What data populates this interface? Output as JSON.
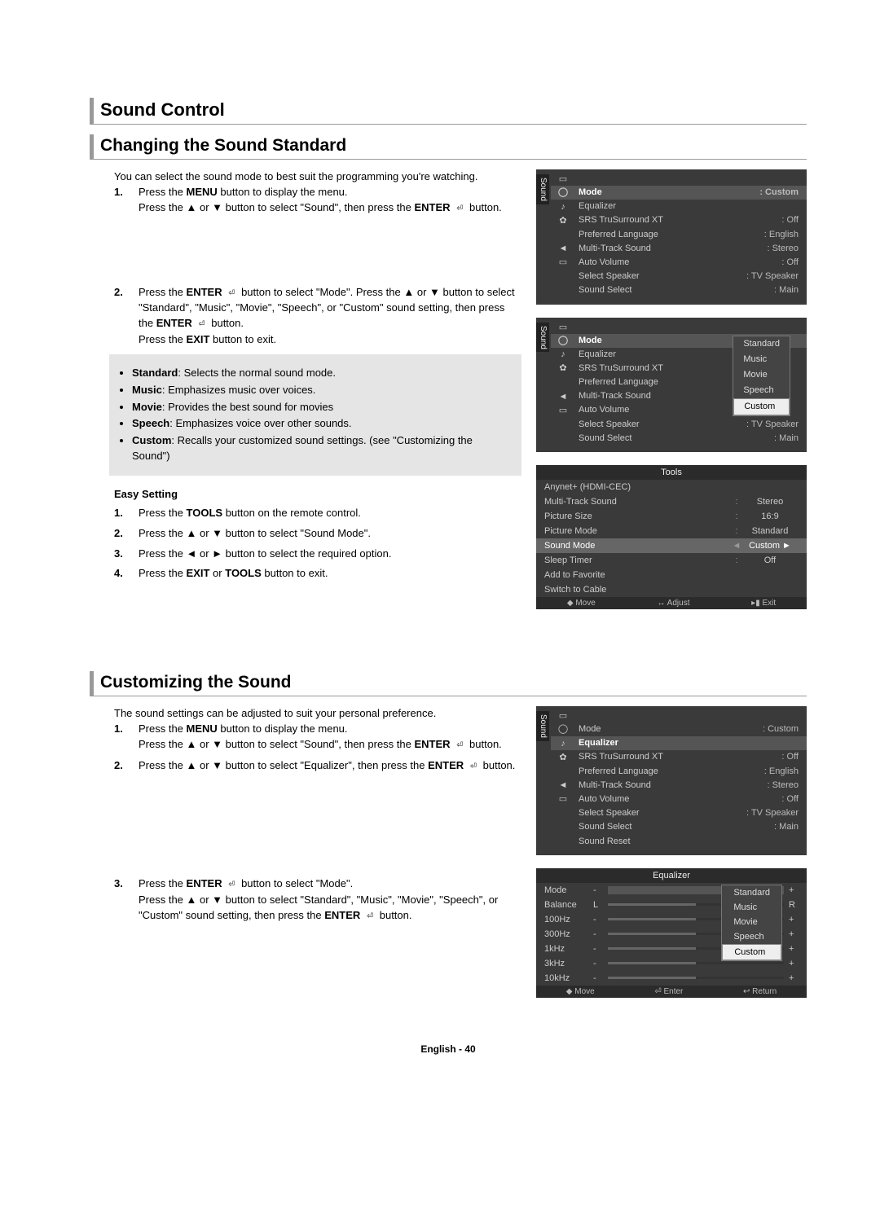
{
  "section_title": "Sound Control",
  "h2_a": "Changing the Sound Standard",
  "intro_a": "You can select the sound mode to best suit the programming you're watching.",
  "step_nums": [
    "1.",
    "2.",
    "3.",
    "4."
  ],
  "a1_l1": "Press the ",
  "menu_b": "MENU",
  "a1_l1b": " button to display the menu.",
  "a1_l2a": "Press the ▲ or ▼ button to select \"Sound\", then press the ",
  "enter_b": "ENTER",
  "enter_glyph": " ⏎ ",
  "a1_l2b": "button.",
  "a2_l1a": "Press the ",
  "a2_l1b": " button to select \"Mode\". Press the ▲ or ▼ button to select \"Standard\", \"Music\", \"Movie\", \"Speech\", or \"Custom\" sound setting, then press the ",
  "a2_l1c": " button.",
  "a2_l2a": "Press the ",
  "exit_b": "EXIT",
  "a2_l2b": " button to exit.",
  "bullets": [
    {
      "b": "Standard",
      "t": ": Selects the normal sound mode."
    },
    {
      "b": "Music",
      "t": ": Emphasizes music over voices."
    },
    {
      "b": "Movie",
      "t": ": Provides the best sound for movies"
    },
    {
      "b": "Speech",
      "t": ": Emphasizes voice over other sounds."
    },
    {
      "b": "Custom",
      "t": ": Recalls your customized sound settings. (see \"Customizing the Sound\")"
    }
  ],
  "easy_head": "Easy Setting",
  "e1": "Press the ",
  "tools_b": "TOOLS",
  "e1b": " button on the remote control.",
  "e2": "Press the ▲ or ▼ button to select \"Sound Mode\".",
  "e3": "Press the ◄ or ► button to select the required option.",
  "e4a": "Press the ",
  "or_word": " or ",
  "e4b": " button to exit.",
  "osd1": {
    "vtab": "Sound",
    "rows": [
      {
        "icon": "▭",
        "label": "",
        "val": ""
      },
      {
        "icon": "◯",
        "label": "Mode",
        "val": "Custom",
        "hl": true
      },
      {
        "icon": "♪",
        "label": "Equalizer",
        "val": ""
      },
      {
        "icon": "✿",
        "label": "SRS TruSurround XT",
        "val": "Off"
      },
      {
        "icon": "",
        "label": "Preferred Language",
        "val": "English"
      },
      {
        "icon": "◄",
        "label": "Multi-Track Sound",
        "val": "Stereo"
      },
      {
        "icon": "▭",
        "label": "Auto Volume",
        "val": "Off"
      },
      {
        "icon": "",
        "label": "Select Speaker",
        "val": "TV Speaker"
      },
      {
        "icon": "",
        "label": "Sound Select",
        "val": "Main"
      }
    ]
  },
  "osd2": {
    "vtab": "Sound",
    "rows": [
      {
        "icon": "▭",
        "label": "",
        "val": ""
      },
      {
        "icon": "◯",
        "label": "Mode",
        "val": "",
        "hl": true
      },
      {
        "icon": "♪",
        "label": "Equalizer",
        "val": ""
      },
      {
        "icon": "✿",
        "label": "SRS TruSurround XT",
        "val": ""
      },
      {
        "icon": "",
        "label": "Preferred Language",
        "val": ""
      },
      {
        "icon": "◄",
        "label": "Multi-Track Sound",
        "val": ""
      },
      {
        "icon": "▭",
        "label": "Auto Volume",
        "val": ""
      },
      {
        "icon": "",
        "label": "Select Speaker",
        "val": "TV Speaker"
      },
      {
        "icon": "",
        "label": "Sound Select",
        "val": "Main"
      }
    ],
    "popup": [
      "Standard",
      "Music",
      "Movie",
      "Speech",
      "Custom"
    ],
    "popup_sel": 4
  },
  "tools": {
    "title": "Tools",
    "rows": [
      {
        "lab": "Anynet+ (HDMI-CEC)",
        "val": ""
      },
      {
        "lab": "Multi-Track Sound",
        "mid": ":",
        "val": "Stereo"
      },
      {
        "lab": "Picture Size",
        "mid": ":",
        "val": "16:9"
      },
      {
        "lab": "Picture Mode",
        "mid": ":",
        "val": "Standard"
      },
      {
        "lab": "Sound Mode",
        "mid": "◄",
        "val": "Custom",
        "hl": true,
        "arrow": "►"
      },
      {
        "lab": "Sleep Timer",
        "mid": ":",
        "val": "Off"
      },
      {
        "lab": "Add to Favorite",
        "val": ""
      },
      {
        "lab": "Switch to Cable",
        "val": ""
      }
    ],
    "foot": [
      "◆ Move",
      "↔ Adjust",
      "▸▮ Exit"
    ]
  },
  "h2_b": "Customizing the Sound",
  "intro_b": "The sound settings can be adjusted to suit your personal preference.",
  "b1_l1": "Press the ",
  "b1_l1b": " button to display the menu.",
  "b1_l2a": "Press the ▲ or ▼ button to select \"Sound\", then press the ",
  "b1_l2b": " button.",
  "b2a": "Press the ▲ or ▼ button to select \"Equalizer\", then press the ",
  "b2b": " button.",
  "b3a": "Press the ",
  "b3b": " button to select \"Mode\".",
  "b3c": "Press the ▲ or ▼ button to select \"Standard\", \"Music\", \"Movie\", \"Speech\", or \"Custom\" sound setting, then press the ",
  "b3d": " button.",
  "osd3": {
    "vtab": "Sound",
    "rows": [
      {
        "icon": "▭",
        "label": "",
        "val": ""
      },
      {
        "icon": "◯",
        "label": "Mode",
        "val": "Custom"
      },
      {
        "icon": "♪",
        "label": "Equalizer",
        "val": "",
        "hl": true
      },
      {
        "icon": "✿",
        "label": "SRS TruSurround XT",
        "val": "Off"
      },
      {
        "icon": "",
        "label": "Preferred Language",
        "val": "English"
      },
      {
        "icon": "◄",
        "label": "Multi-Track Sound",
        "val": "Stereo"
      },
      {
        "icon": "▭",
        "label": "Auto Volume",
        "val": "Off"
      },
      {
        "icon": "",
        "label": "Select Speaker",
        "val": "TV Speaker"
      },
      {
        "icon": "",
        "label": "Sound Select",
        "val": "Main"
      },
      {
        "icon": "",
        "label": "Sound Reset",
        "val": ""
      }
    ]
  },
  "eq": {
    "title": "Equalizer",
    "rows": [
      "Mode",
      "Balance",
      "100Hz",
      "300Hz",
      "1kHz",
      "3kHz",
      "10kHz"
    ],
    "l_mark": "L",
    "r_mark": "R",
    "minus": "-",
    "plus": "+",
    "popup": [
      "Standard",
      "Music",
      "Movie",
      "Speech",
      "Custom"
    ],
    "popup_sel": 4,
    "foot": [
      "◆ Move",
      "⏎ Enter",
      "↩ Return"
    ]
  },
  "footer": "English - 40"
}
